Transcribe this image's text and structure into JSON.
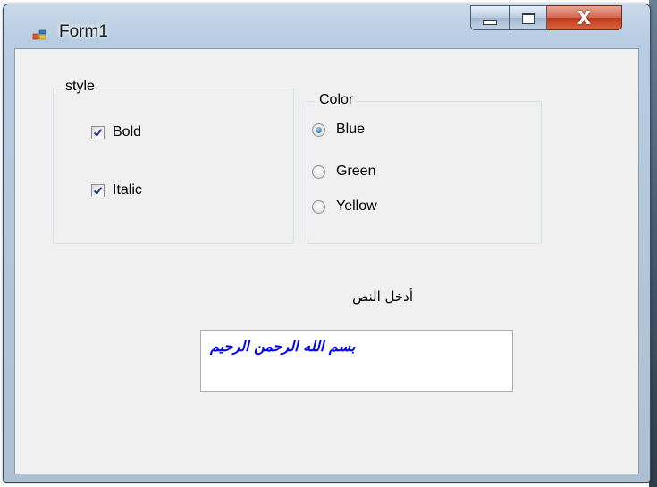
{
  "window": {
    "title": "Form1",
    "close_glyph": "X"
  },
  "style_group": {
    "legend": "style",
    "bold_label": "Bold",
    "bold_checked": true,
    "italic_label": "Italic",
    "italic_checked": true
  },
  "color_group": {
    "legend": "Color",
    "options": [
      {
        "label": "Blue",
        "selected": true
      },
      {
        "label": "Green",
        "selected": false
      },
      {
        "label": "Yellow",
        "selected": false
      }
    ]
  },
  "input": {
    "label": "أدخل النص",
    "value": "بسم الله الرحمن الرحيم",
    "text_color": "#0000ff"
  },
  "icons": {
    "app": "form-window-icon",
    "minimize": "minimize-icon",
    "maximize": "maximize-icon",
    "close": "close-icon",
    "check": "checkmark-icon",
    "radio": "radio-dot-icon"
  }
}
